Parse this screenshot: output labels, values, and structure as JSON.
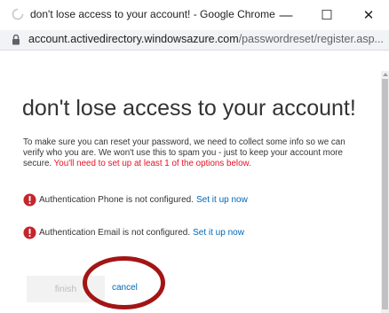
{
  "window": {
    "title": "don't lose access to your account! - Google Chrome",
    "minimize_glyph": "—",
    "maximize_glyph": "☐",
    "close_glyph": "✕"
  },
  "address_bar": {
    "host": "account.activedirectory.windowsazure.com",
    "path": "/passwordreset/register.asp..."
  },
  "page": {
    "heading": "don't lose access to your account!",
    "intro": "To make sure you can reset your password, we need to collect some info so we can verify who you are. We won't use this to spam you - just to keep your account more secure. ",
    "intro_warning": "You'll need to set up at least 1 of the options below.",
    "methods": [
      {
        "status": "Authentication Phone is not configured.",
        "action": "Set it up now"
      },
      {
        "status": "Authentication Email is not configured.",
        "action": "Set it up now"
      }
    ],
    "finish_label": "finish",
    "cancel_label": "cancel"
  },
  "colors": {
    "link": "#0067b8",
    "warning": "#e81123",
    "alert_icon": "#c4262e",
    "annotation": "#a31515"
  },
  "icons": {
    "tab_loading": "loading-spinner-icon",
    "lock": "lock-icon",
    "alert": "exclamation-circle-icon"
  }
}
